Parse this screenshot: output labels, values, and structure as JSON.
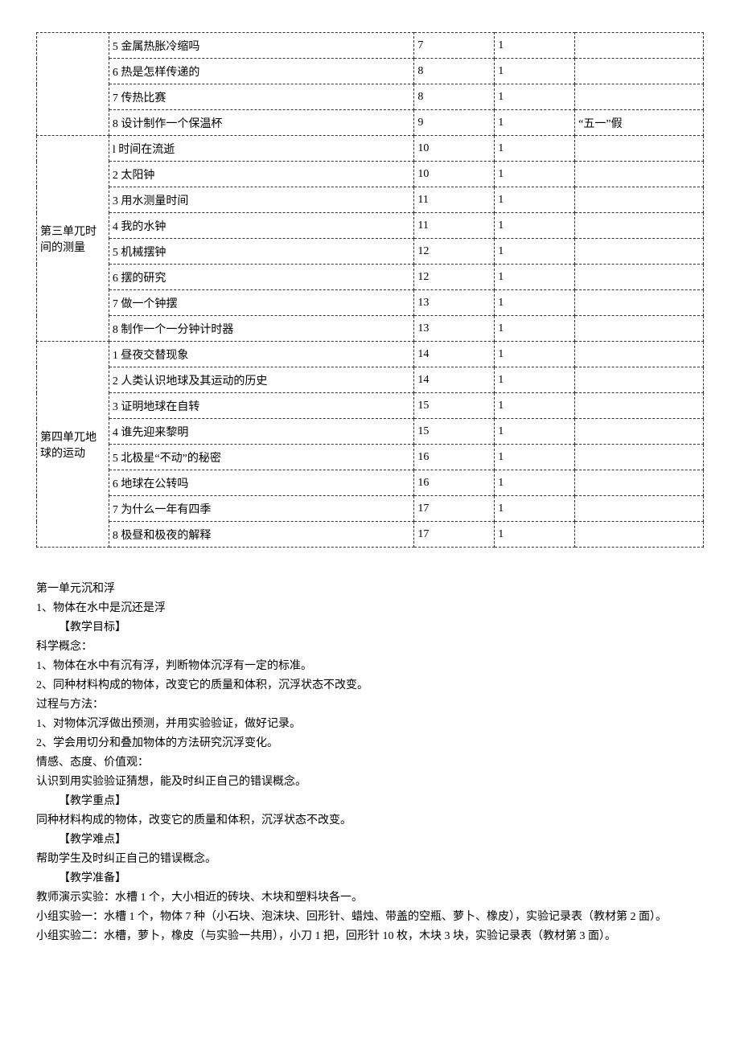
{
  "table": {
    "groups": [
      {
        "unit": "",
        "rows": [
          {
            "topic": "5 金属热胀冷缩吗",
            "week": "7",
            "hours": "1",
            "note": ""
          },
          {
            "topic": "6 热是怎样传递的",
            "week": "8",
            "hours": "1",
            "note": ""
          },
          {
            "topic": "7 传热比赛",
            "week": "8",
            "hours": "1",
            "note": ""
          },
          {
            "topic": "8 设计制作一个保温杯",
            "week": "9",
            "hours": "1",
            "note": "“五一”假"
          }
        ]
      },
      {
        "unit": "第三单兀时间的测量",
        "rows": [
          {
            "topic": "l 时间在流逝",
            "week": "10",
            "hours": "1",
            "note": ""
          },
          {
            "topic": "2 太阳钟",
            "week": "10",
            "hours": "1",
            "note": ""
          },
          {
            "topic": "3 用水测量时间",
            "week": "11",
            "hours": "1",
            "note": ""
          },
          {
            "topic": "4 我的水钟",
            "week": "11",
            "hours": "1",
            "note": ""
          },
          {
            "topic": "5 机械摆钟",
            "week": "12",
            "hours": "1",
            "note": ""
          },
          {
            "topic": "6 摆的研究",
            "week": "12",
            "hours": "1",
            "note": ""
          },
          {
            "topic": "7 做一个钟摆",
            "week": "13",
            "hours": "1",
            "note": ""
          },
          {
            "topic": "8 制作一个一分钟计时器",
            "week": "13",
            "hours": "1",
            "note": ""
          }
        ]
      },
      {
        "unit": "第四单兀地球的运动",
        "rows": [
          {
            "topic": "1 昼夜交替现象",
            "week": "14",
            "hours": "1",
            "note": ""
          },
          {
            "topic": "2 人类认识地球及其运动的历史",
            "week": "14",
            "hours": "1",
            "note": ""
          },
          {
            "topic": "3 证明地球在自转",
            "week": "15",
            "hours": "1",
            "note": ""
          },
          {
            "topic": "4 谁先迎来黎明",
            "week": "15",
            "hours": "1",
            "note": ""
          },
          {
            "topic": "5 北极星“不动”的秘密",
            "week": "16",
            "hours": "1",
            "note": ""
          },
          {
            "topic": "6 地球在公转吗",
            "week": "16",
            "hours": "1",
            "note": ""
          },
          {
            "topic": "7 为什么一年有四季",
            "week": "17",
            "hours": "1",
            "note": ""
          },
          {
            "topic": "8 极昼和极夜的解释",
            "week": "17",
            "hours": "1",
            "note": ""
          }
        ]
      }
    ]
  },
  "content": {
    "unit_title": "第一单元沉和浮",
    "lesson_title": "1、物体在水中是沉还是浮",
    "goal_heading": "【教学目标】",
    "concept_label": "科学概念：",
    "concept_1": "1、物体在水中有沉有浮，判断物体沉浮有一定的标准。",
    "concept_2": "2、同种材料构成的物体，改变它的质量和体积，沉浮状态不改变。",
    "process_label": "过程与方法：",
    "process_1": "1、对物体沉浮做出预测，并用实验验证，做好记录。",
    "process_2": "2、学会用切分和叠加物体的方法研究沉浮变化。",
    "emotion_label": "情感、态度、价值观：",
    "emotion_1": "认识到用实验验证猜想，能及时纠正自己的错误概念。",
    "keypoint_heading": "【教学重点】",
    "keypoint_1": "同种材料构成的物体，改变它的质量和体积，沉浮状态不改变。",
    "difficulty_heading": "【教学难点】",
    "difficulty_1": "帮助学生及时纠正自己的错误概念。",
    "prep_heading": "【教学准备】",
    "prep_1": "教师演示实验：水槽 1 个，大小相近的砖块、木块和塑料块各一。",
    "prep_2": "小组实验一：水槽 1 个，物体 7 种（小石块、泡沫块、回形针、蜡烛、带盖的空瓶、萝卜、橡皮），实验记录表（教材第 2 面）。",
    "prep_3": "小组实验二：水槽，萝卜，橡皮（与实验一共用），小刀 1 把，回形针 10 枚，木块 3 块，实验记录表（教材第 3 面）。"
  }
}
